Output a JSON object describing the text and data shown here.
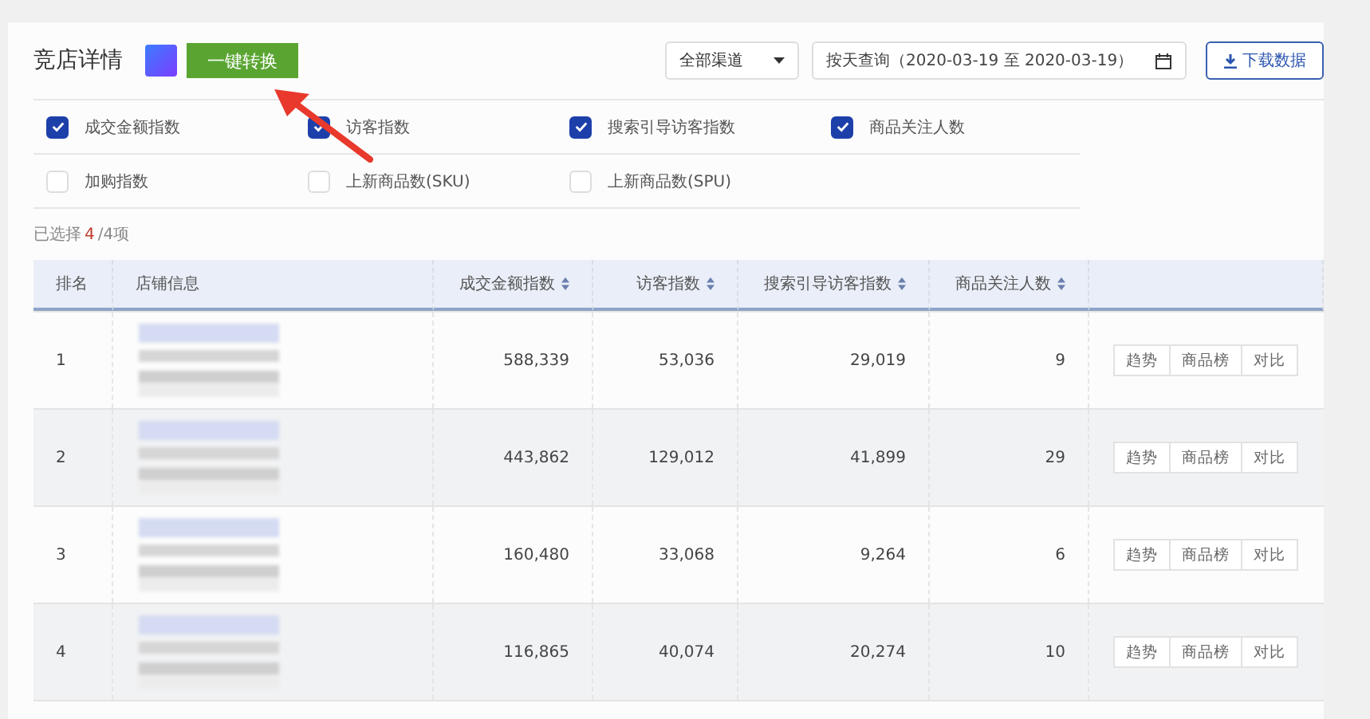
{
  "header": {
    "title": "竞店详情",
    "convert_button": "一键转换",
    "channel_select": "全部渠道",
    "date_range": "按天查询（2020-03-19 至 2020-03-19）",
    "download_button": "下载数据"
  },
  "metrics": [
    {
      "label": "成交金额指数",
      "checked": true
    },
    {
      "label": "访客指数",
      "checked": true
    },
    {
      "label": "搜索引导访客指数",
      "checked": true
    },
    {
      "label": "商品关注人数",
      "checked": true
    },
    {
      "label": "加购指数",
      "checked": false
    },
    {
      "label": "上新商品数(SKU)",
      "checked": false
    },
    {
      "label": "上新商品数(SPU)",
      "checked": false
    }
  ],
  "selection": {
    "prefix": "已选择",
    "count": "4",
    "suffix": "/4项"
  },
  "table": {
    "columns": [
      {
        "label": "排名",
        "sortable": false
      },
      {
        "label": "店铺信息",
        "sortable": false
      },
      {
        "label": "成交金额指数",
        "sortable": true
      },
      {
        "label": "访客指数",
        "sortable": true
      },
      {
        "label": "搜索引导访客指数",
        "sortable": true
      },
      {
        "label": "商品关注人数",
        "sortable": true
      }
    ],
    "rows": [
      {
        "rank": "1",
        "values": [
          "588,339",
          "53,036",
          "29,019",
          "9"
        ],
        "actions": [
          "趋势",
          "商品榜",
          "对比"
        ]
      },
      {
        "rank": "2",
        "values": [
          "443,862",
          "129,012",
          "41,899",
          "29"
        ],
        "actions": [
          "趋势",
          "商品榜",
          "对比"
        ]
      },
      {
        "rank": "3",
        "values": [
          "160,480",
          "33,068",
          "9,264",
          "6"
        ],
        "actions": [
          "趋势",
          "商品榜",
          "对比"
        ]
      },
      {
        "rank": "4",
        "values": [
          "116,865",
          "40,074",
          "20,274",
          "10"
        ],
        "actions": [
          "趋势",
          "商品榜",
          "对比"
        ]
      }
    ]
  },
  "annotation": {
    "kind": "arrow"
  }
}
